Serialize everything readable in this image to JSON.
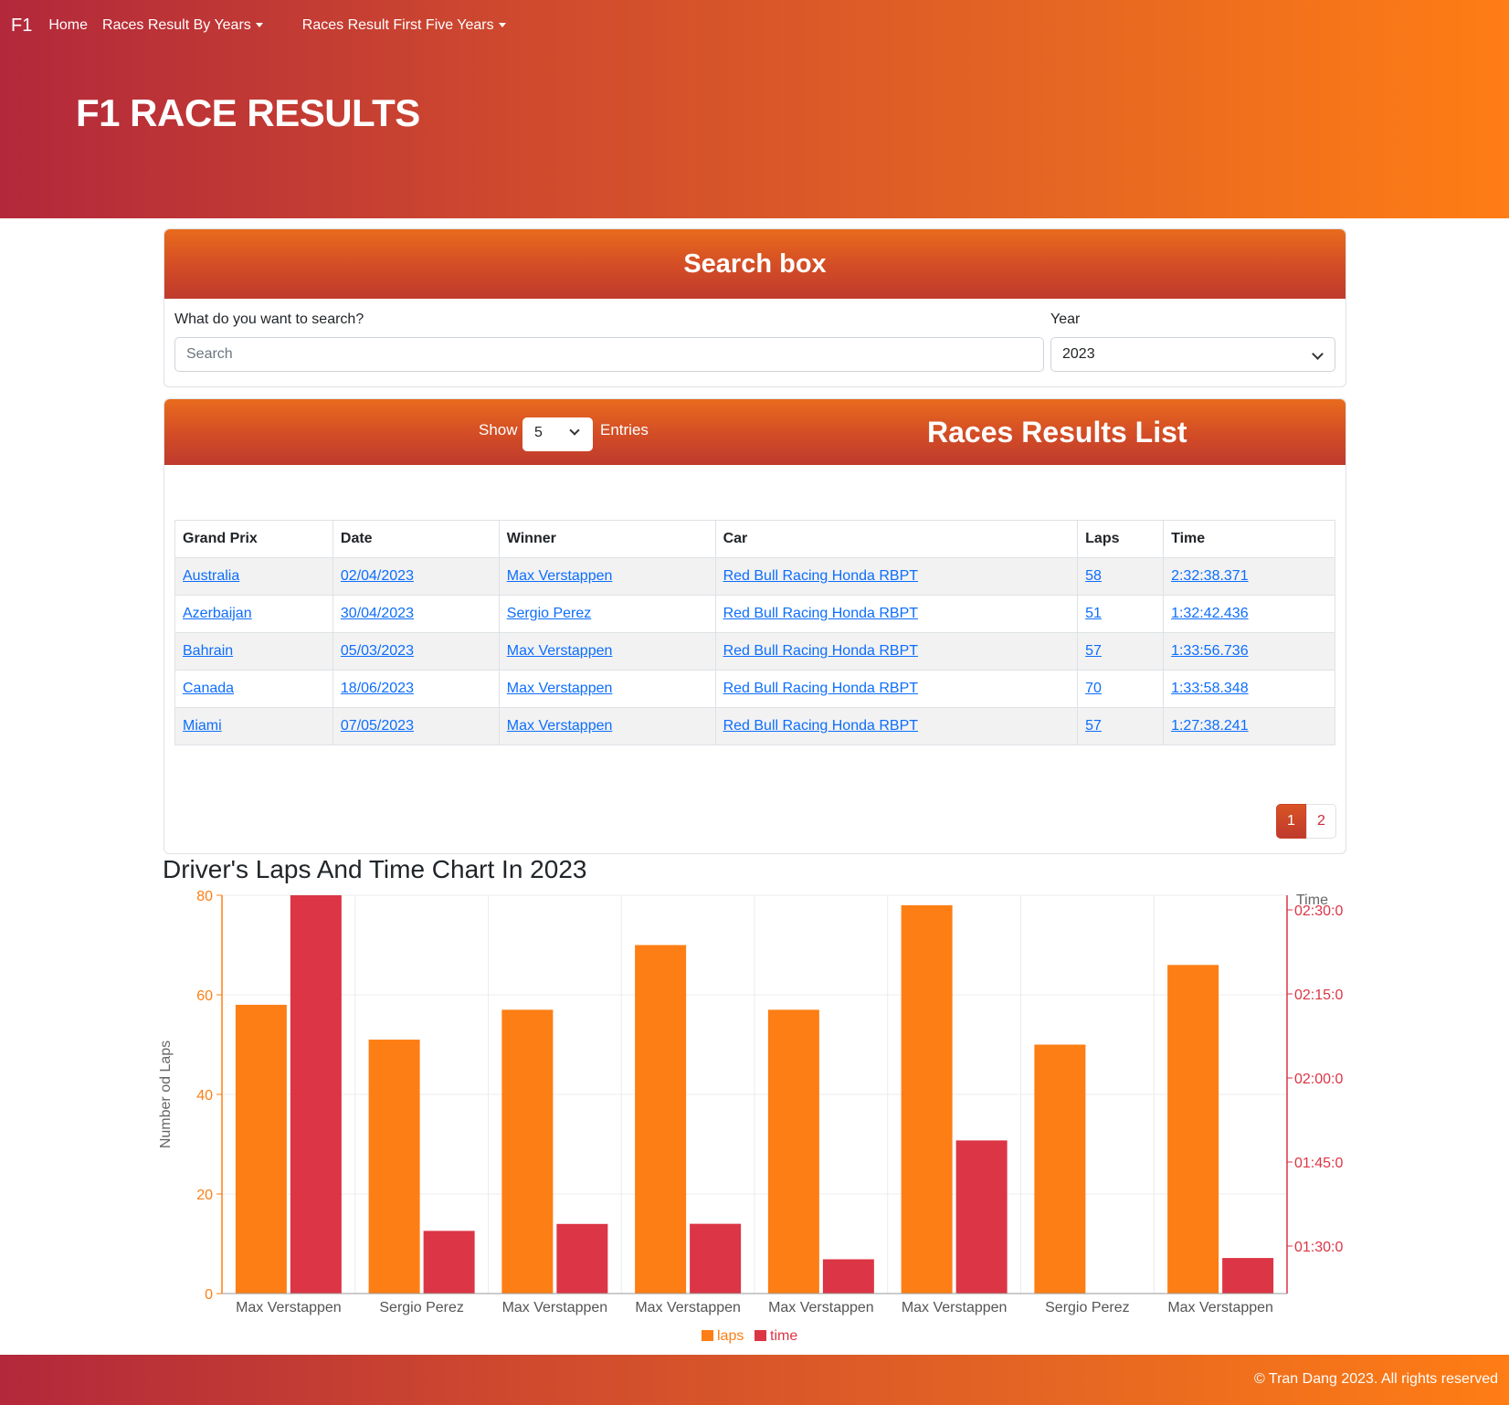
{
  "nav": {
    "brand": "F1",
    "home": "Home",
    "by_years": "Races Result By Years",
    "first_five": "Races Result First Five Years"
  },
  "hero": {
    "title": "F1 RACE RESULTS"
  },
  "search": {
    "header": "Search box",
    "query_label": "What do you want to search?",
    "query_placeholder": "Search",
    "year_label": "Year",
    "year_value": "2023"
  },
  "results": {
    "show_label": "Show",
    "entries_value": "5",
    "entries_label": "Entries",
    "title": "Races Results List",
    "columns": [
      "Grand Prix",
      "Date",
      "Winner",
      "Car",
      "Laps",
      "Time"
    ],
    "rows": [
      [
        "Australia",
        "02/04/2023",
        "Max Verstappen",
        "Red Bull Racing Honda RBPT",
        "58",
        "2:32:38.371"
      ],
      [
        "Azerbaijan",
        "30/04/2023",
        "Sergio Perez",
        "Red Bull Racing Honda RBPT",
        "51",
        "1:32:42.436"
      ],
      [
        "Bahrain",
        "05/03/2023",
        "Max Verstappen",
        "Red Bull Racing Honda RBPT",
        "57",
        "1:33:56.736"
      ],
      [
        "Canada",
        "18/06/2023",
        "Max Verstappen",
        "Red Bull Racing Honda RBPT",
        "70",
        "1:33:58.348"
      ],
      [
        "Miami",
        "07/05/2023",
        "Max Verstappen",
        "Red Bull Racing Honda RBPT",
        "57",
        "1:27:38.241"
      ]
    ],
    "pages": [
      "1",
      "2"
    ],
    "active_page": "1"
  },
  "chart_title": "Driver's Laps And Time Chart In 2023",
  "chart_data": {
    "type": "bar",
    "categories": [
      "Max Verstappen",
      "Sergio Perez",
      "Max Verstappen",
      "Max Verstappen",
      "Max Verstappen",
      "Max Verstappen",
      "Sergio Perez",
      "Max Verstappen"
    ],
    "series": [
      {
        "name": "laps",
        "axis": "left",
        "color": "#fd7e14",
        "values": [
          58,
          51,
          57,
          70,
          57,
          78,
          50,
          66
        ]
      },
      {
        "name": "time",
        "axis": "right",
        "color": "#dc3545",
        "values": [
          "2:32:38.371",
          "1:32:42.436",
          "1:33:56.736",
          "1:33:58.348",
          "1:27:38.241",
          "1:48:51",
          "1:21:12",
          "1:27:52"
        ]
      }
    ],
    "ylabel": "Number od Laps",
    "ylim": [
      0,
      80
    ],
    "yticks": [
      "0",
      "20",
      "40",
      "60",
      "80"
    ],
    "y2label": "Time",
    "y2ticks": [
      "01:30:0",
      "01:45:0",
      "02:00:0",
      "02:15:0",
      "02:30:0"
    ],
    "grid": true,
    "legend": "bottom"
  },
  "footer": {
    "text": "© Tran Dang 2023. All rights reserved"
  },
  "colors": {
    "brand_start": "#b3283b",
    "brand_end": "#ff7d14",
    "laps": "#fd7e14",
    "time": "#dc3545",
    "link": "#0d6efd"
  }
}
